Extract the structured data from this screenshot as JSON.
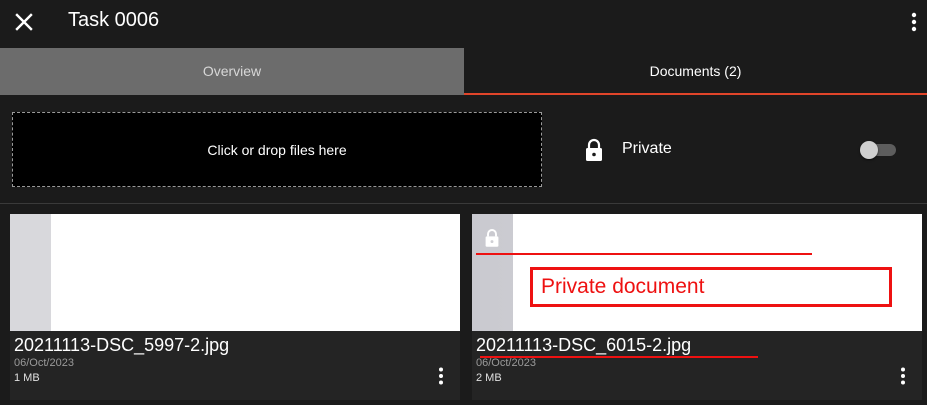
{
  "appbar": {
    "title": "Task 0006"
  },
  "tabs": [
    {
      "label": "Overview"
    },
    {
      "label": "Documents (2)"
    }
  ],
  "dropzone": {
    "label": "Click or drop files here"
  },
  "private": {
    "label": "Private",
    "enabled": false
  },
  "documents": [
    {
      "filename": "20211113-DSC_5997-2.jpg",
      "date": "06/Oct/2023",
      "size": "1 MB",
      "private": false
    },
    {
      "filename": "20211113-DSC_6015-2.jpg",
      "date": "06/Oct/2023",
      "size": "2 MB",
      "private": true
    }
  ],
  "annotation": {
    "label": "Private document"
  },
  "colors": {
    "accent": "#e1452a",
    "annotation": "#ee1111"
  },
  "icons": {
    "close": "close-icon",
    "menu": "more-vert-icon",
    "lock": "lock-icon"
  }
}
